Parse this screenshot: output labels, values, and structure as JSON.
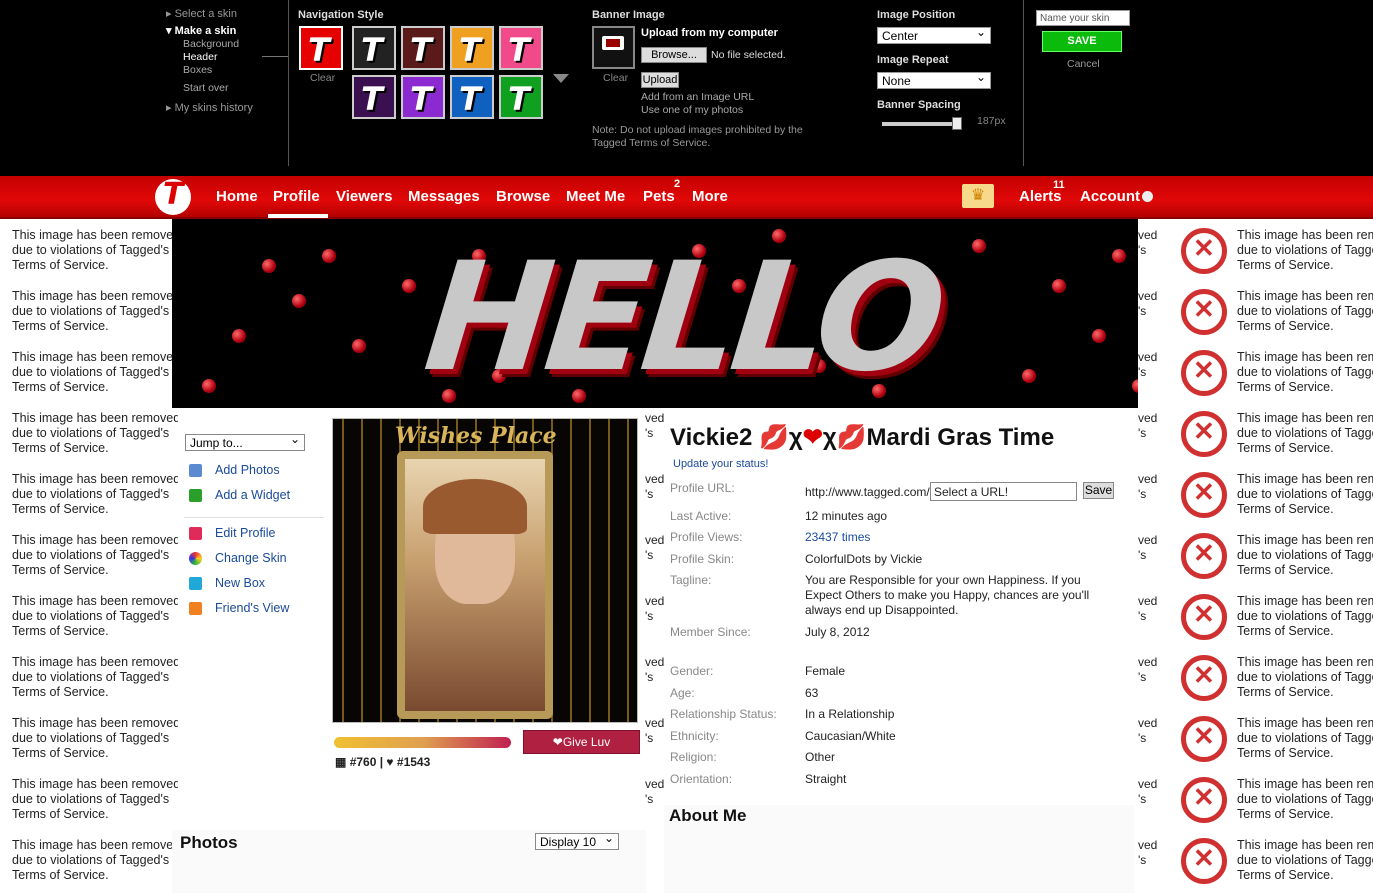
{
  "skin_menu": {
    "select_skin": "Select a skin",
    "make_skin": "Make a skin",
    "sub_items": [
      "Background",
      "Header",
      "Boxes"
    ],
    "start_over": "Start over",
    "history": "My skins history"
  },
  "nav_style": {
    "title": "Navigation Style",
    "clear": "Clear",
    "swatches": [
      "#e60000",
      "#222222",
      "#5a1a1a",
      "#f0a020",
      "#f04a8a",
      "#3a1050",
      "#8a2ad0",
      "#1060c0",
      "#10a020"
    ],
    "glyph": "T"
  },
  "banner_image": {
    "title": "Banner Image",
    "upload_label": "Upload from my computer",
    "browse": "Browse...",
    "no_file": "No file selected.",
    "clear": "Clear",
    "upload": "Upload",
    "add_url": "Add from an Image URL",
    "use_photos": "Use one of my photos",
    "note": "Note: Do not upload images prohibited by the Tagged Terms of Service."
  },
  "image_position": {
    "title": "Image Position",
    "value": "Center"
  },
  "image_repeat": {
    "title": "Image Repeat",
    "value": "None"
  },
  "banner_spacing": {
    "title": "Banner Spacing",
    "value": "187px",
    "level": 0.95
  },
  "save_area": {
    "placeholder": "Name your skin",
    "save": "SAVE",
    "cancel": "Cancel"
  },
  "nav": {
    "items": [
      "Home",
      "Profile",
      "Viewers",
      "Messages",
      "Browse",
      "Meet Me",
      "Pets",
      "More"
    ],
    "pets_badge": "2",
    "alerts": "Alerts",
    "alerts_badge": "11",
    "account": "Account"
  },
  "removed": {
    "l1": "This image has been removed",
    "l2": "due to violations of Tagged's",
    "l3": "Terms of Service."
  },
  "removed_right": {
    "l1": "This image has been rem",
    "l2": "due to violations of Tagge",
    "l3": "Terms of Service."
  },
  "removed_stripe": {
    "a": "ved",
    "b": "'s"
  },
  "left_panel": {
    "jump": "Jump to...",
    "links": [
      "Add Photos",
      "Add a Widget",
      "Edit Profile",
      "Change Skin",
      "New Box",
      "Friend's View"
    ]
  },
  "photo_caption": "Wishes Place",
  "ranks": {
    "rank1": "#760",
    "rank2": "#1543",
    "give_luv": "Give Luv"
  },
  "profile": {
    "name": "Vickie2",
    "name_tail": "Mardi Gras Time",
    "status_link": "Update your status!",
    "url_label": "Profile URL:",
    "url_value": "http://www.tagged.com/",
    "url_select": "Select a URL!",
    "url_save": "Save",
    "fields": [
      {
        "k": "Last Active:",
        "v": "12 minutes ago"
      },
      {
        "k": "Profile Views:",
        "v": "23437 times"
      },
      {
        "k": "Profile Skin:",
        "v": "ColorfulDots by Vickie"
      },
      {
        "k": "Tagline:",
        "v": "You are Responsible for your own Happiness. If you Expect Others to make you Happy, chances are you'll always end up Disappointed."
      },
      {
        "k": "Member Since:",
        "v": "July 8, 2012"
      },
      {
        "k": "Gender:",
        "v": "Female"
      },
      {
        "k": "Age:",
        "v": "63"
      },
      {
        "k": "Relationship Status:",
        "v": "In a Relationship"
      },
      {
        "k": "Ethnicity:",
        "v": "Caucasian/White"
      },
      {
        "k": "Religion:",
        "v": "Other"
      },
      {
        "k": "Orientation:",
        "v": "Straight"
      }
    ]
  },
  "photos": {
    "title": "Photos",
    "display": "Display 10"
  },
  "about": {
    "title": "About Me"
  }
}
